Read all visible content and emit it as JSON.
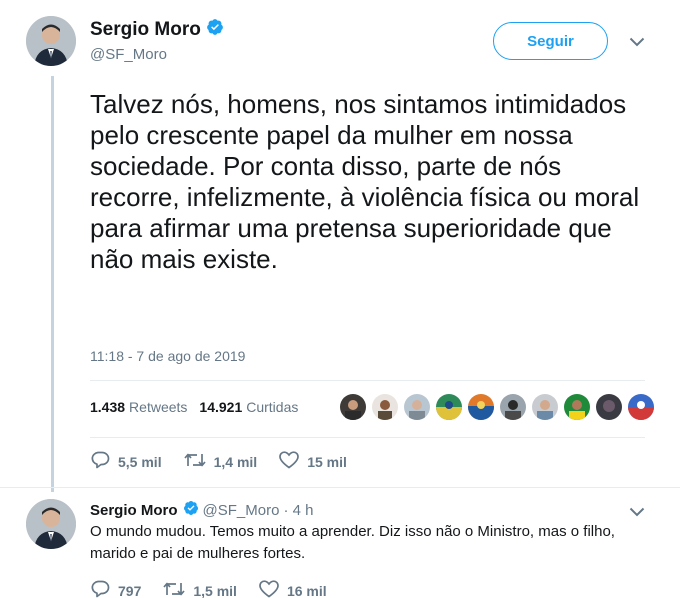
{
  "tweet": {
    "author_name": "Sergio Moro",
    "author_handle": "@SF_Moro",
    "follow_label": "Seguir",
    "text": "Talvez nós, homens, nos sintamos intimidados pelo crescente papel da mulher em nossa sociedade. Por conta disso, parte de nós recorre, infelizmente, à violência física ou moral para afirmar uma pretensa superioridade que não mais existe.",
    "timestamp": "11:18 - 7 de ago de 2019",
    "stats": {
      "retweets_count": "1.438",
      "retweets_label": "Retweets",
      "likes_count": "14.921",
      "likes_label": "Curtidas"
    },
    "actions": {
      "replies": "5,5 mil",
      "retweets": "1,4 mil",
      "likes": "15 mil"
    }
  },
  "reply": {
    "author_name": "Sergio Moro",
    "author_handle": "@SF_Moro",
    "time": "· 4 h",
    "text": "O mundo mudou. Temos muito a aprender. Diz isso não o Ministro, mas o filho, marido e pai de mulheres fortes.",
    "actions": {
      "replies": "797",
      "retweets": "1,5 mil",
      "likes": "16 mil"
    }
  },
  "icons": [
    "verified-badge-icon",
    "chevron-down-icon",
    "reply-icon",
    "retweet-icon",
    "like-icon"
  ],
  "colors": {
    "accent": "#1da1f2",
    "text": "#14171a",
    "secondary_text": "#657786",
    "thread_line": "#c4d3dd"
  }
}
